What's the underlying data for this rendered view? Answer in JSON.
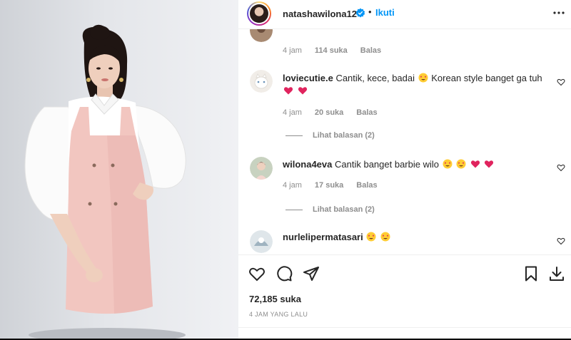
{
  "header": {
    "username": "natashawilona12",
    "separator": "•",
    "follow_label": "Ikuti"
  },
  "comments": [
    {
      "user": "",
      "text": "",
      "time": "4 jam",
      "likes": "114 suka",
      "reply": "Balas"
    },
    {
      "user": "loviecutie.e",
      "text": "Cantik, kece, badai",
      "text2": "Korean style banget ga tuh",
      "time": "4 jam",
      "likes": "20 suka",
      "reply": "Balas",
      "view_replies": "Lihat balasan (2)"
    },
    {
      "user": "wilona4eva",
      "text": "Cantik banget barbie wilo",
      "time": "4 jam",
      "likes": "17 suka",
      "reply": "Balas",
      "view_replies": "Lihat balasan (2)"
    },
    {
      "user": "nurlelipermatasari",
      "text": ""
    }
  ],
  "footer": {
    "likes": "72,185 suka",
    "time_ago": "4 JAM YANG LALU"
  },
  "colors": {
    "link_blue": "#0095f6",
    "heart_red": "#ed4956",
    "muted": "#8e8e8e"
  },
  "icons": [
    "verified-icon",
    "more-icon",
    "heart-icon",
    "comment-icon",
    "share-icon",
    "bookmark-icon",
    "download-icon",
    "heart-eyes-emoji",
    "red-heart-emoji"
  ]
}
